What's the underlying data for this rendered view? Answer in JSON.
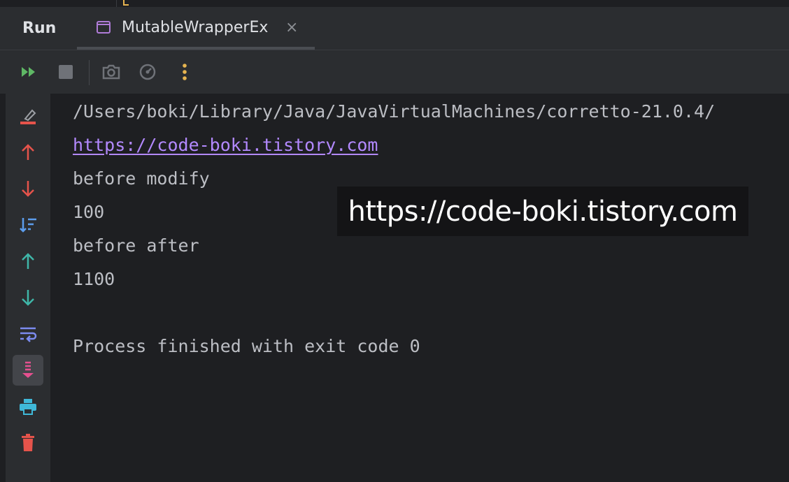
{
  "tool_window": {
    "title": "Run"
  },
  "tab": {
    "label": "MutableWrapperEx",
    "close_glyph": "×"
  },
  "toolbar": {
    "icons": [
      "rerun-icon",
      "stop-icon",
      "camera-icon",
      "dashboard-icon",
      "more-icon"
    ]
  },
  "gutter": {
    "icons": [
      "clear-icon",
      "up-red-icon",
      "down-red-icon",
      "sort-icon",
      "up-green-icon",
      "down-green-icon",
      "soft-wrap-icon",
      "scroll-to-end-icon",
      "print-icon",
      "trash-icon"
    ]
  },
  "console": {
    "lines": [
      "/Users/boki/Library/Java/JavaVirtualMachines/corretto-21.0.4/",
      "https://code-boki.tistory.com",
      "before modify",
      "100",
      "before after",
      "1100",
      "",
      "Process finished with exit code 0"
    ]
  },
  "watermark": {
    "text": "https://code-boki.tistory.com"
  },
  "colors": {
    "accent_green": "#5fb865",
    "accent_red": "#e5534b",
    "accent_blue": "#5c9ded",
    "accent_teal": "#3fb6a8",
    "link": "#b389ff",
    "pink": "#e5508f",
    "cyan": "#3fb8d8"
  }
}
